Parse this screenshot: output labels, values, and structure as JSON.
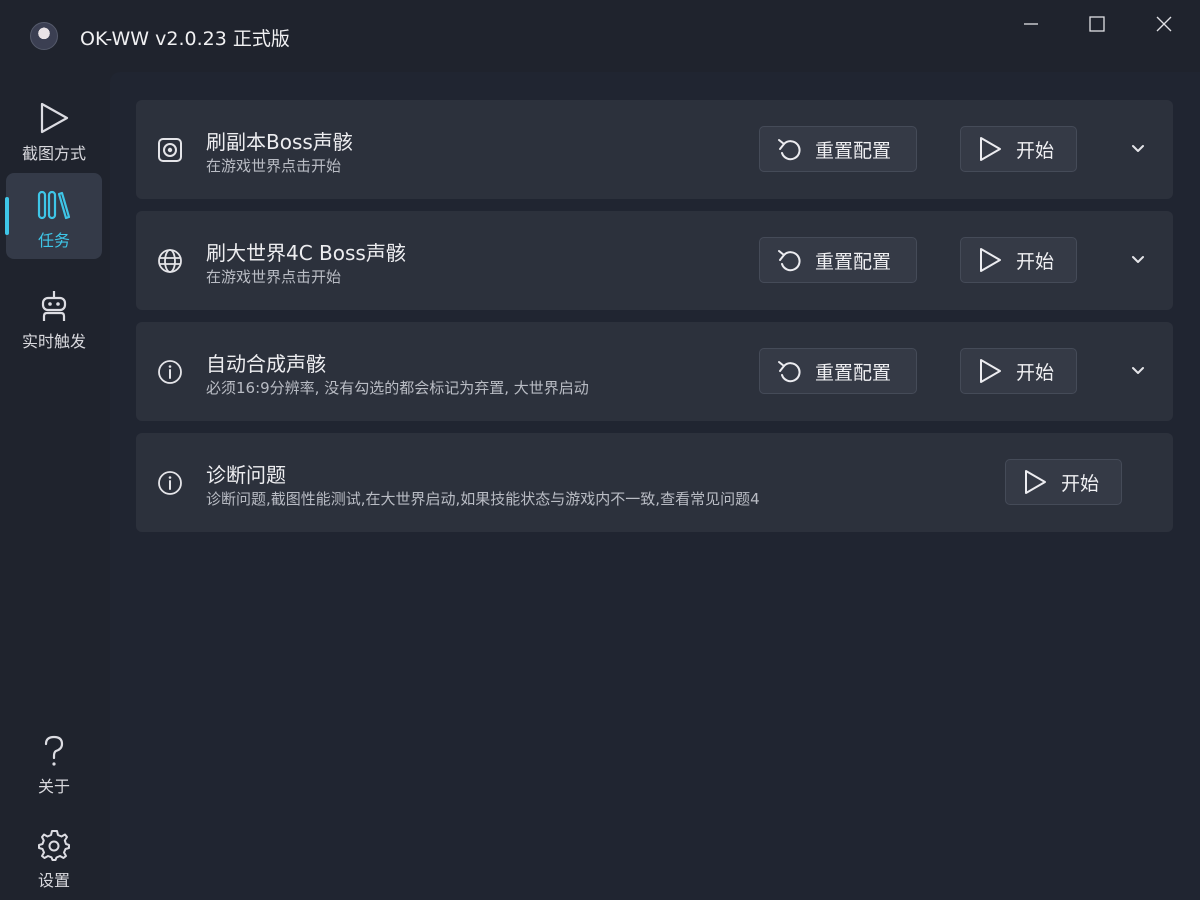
{
  "window": {
    "title": "OK-WW v2.0.23 正式版",
    "app_icon": "avatar-icon",
    "controls": [
      "minimize-icon",
      "maximize-icon",
      "close-icon"
    ]
  },
  "sidebar": {
    "items": [
      {
        "label": "截图方式",
        "icon": "play-icon",
        "active": false
      },
      {
        "label": "任务",
        "icon": "library-icon",
        "active": true
      },
      {
        "label": "实时触发",
        "icon": "robot-icon",
        "active": false
      }
    ],
    "bottom_items": [
      {
        "label": "关于",
        "icon": "question-icon"
      },
      {
        "label": "设置",
        "icon": "gear-icon"
      }
    ]
  },
  "tasks": [
    {
      "title": "刷副本Boss声骸",
      "description": "在游戏世界点击开始",
      "icon": "target-icon",
      "reset_label": "重置配置",
      "start_label": "开始"
    },
    {
      "title": "刷大世界4C Boss声骸",
      "description": "在游戏世界点击开始",
      "icon": "globe-icon",
      "reset_label": "重置配置",
      "start_label": "开始"
    },
    {
      "title": "自动合成声骸",
      "description": "必须16:9分辨率, 没有勾选的都会标记为弃置, 大世界启动",
      "icon": "info-icon",
      "reset_label": "重置配置",
      "start_label": "开始"
    },
    {
      "title": "诊断问题",
      "description": "诊断问题,截图性能测试,在大世界启动,如果技能状态与游戏内不一致,查看常见问题4",
      "icon": "info-icon",
      "start_label": "开始"
    }
  ],
  "colors": {
    "accent": "#3ec6e8",
    "background": "#1f232d",
    "card": "#2c313c",
    "button": "#353a46"
  }
}
